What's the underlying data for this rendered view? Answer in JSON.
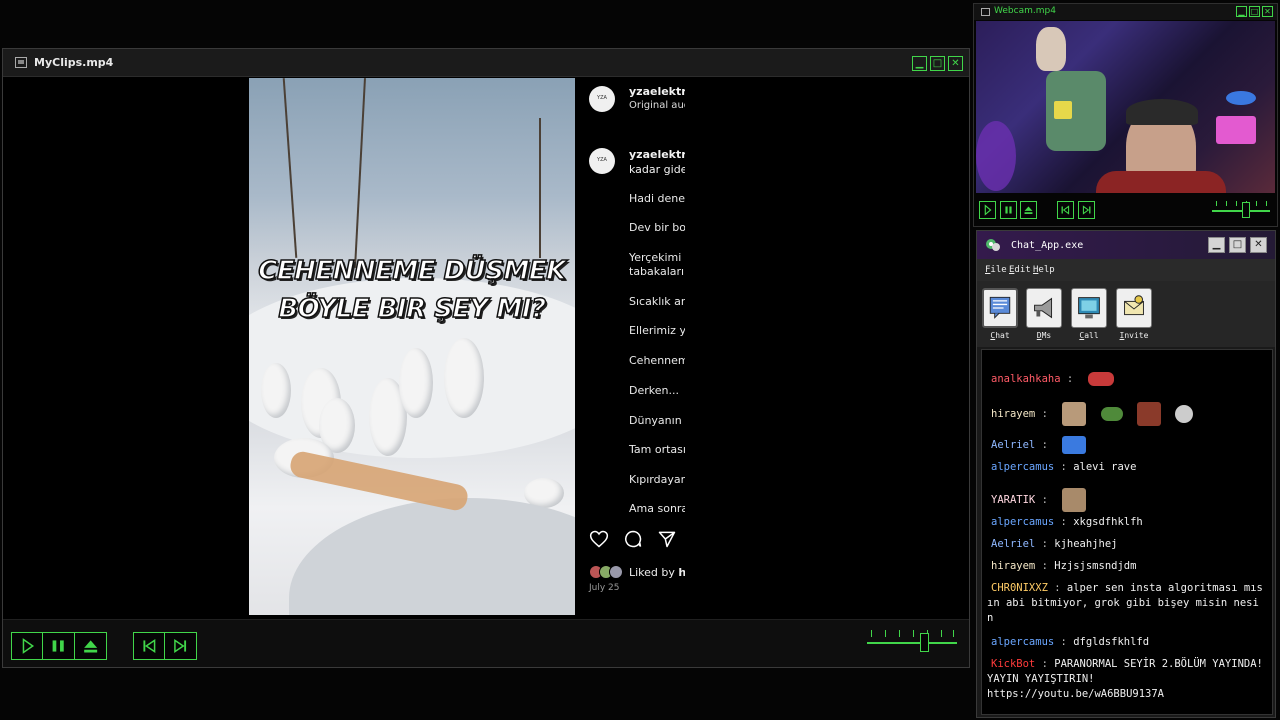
{
  "player": {
    "title": "MyClips.mp4",
    "video_caption_line1": "CEHENNEME DÜŞMEK",
    "video_caption_line2": "BÖYLE BIR ŞEY MI?",
    "ig": {
      "avatar_label": "YZA",
      "username": "yzaelektror",
      "audio": "Original audi",
      "comment_user": "yzaelektror",
      "comment_line2": "kadar gidel",
      "lines": [
        "Hadi deney",
        "Dev bir bor",
        "Yerçekimi b",
        "tabakaları..",
        "Sıcaklık art",
        "Ellerimiz ya",
        "Cehennem",
        "Derken...",
        "Dünyanın r",
        "Tam ortası.",
        "Kıpırdayam",
        "Ama sonra"
      ],
      "liked_by_prefix": "Liked by ",
      "liked_by_name": "h",
      "date": "July 25"
    },
    "volume_level": 0.65,
    "accent_color": "#41d64a"
  },
  "webcam": {
    "title": "Webcam.mp4",
    "volume_level": 0.6
  },
  "chat": {
    "title": "Chat_App.exe",
    "menu": [
      "File",
      "Edit",
      "Help"
    ],
    "tabs": [
      {
        "label": "Chat",
        "icon": "chat-icon"
      },
      {
        "label": "DMs",
        "icon": "megaphone-icon"
      },
      {
        "label": "Call",
        "icon": "monitor-icon"
      },
      {
        "label": "Invite",
        "icon": "mail-icon"
      }
    ],
    "messages": [
      {
        "user": "analkahkaha",
        "color": "#ff5b67",
        "text": ""
      },
      {
        "user": "hirayem",
        "color": "#f5e8c8",
        "text": ""
      },
      {
        "user": "Aelriel",
        "color": "#8fb8ff",
        "text": ""
      },
      {
        "user": "alpercamus",
        "color": "#6aa6ff",
        "text": "alevi rave"
      },
      {
        "user": "YARATIK",
        "color": "#ffd7e0",
        "text": ""
      },
      {
        "user": "alpercamus",
        "color": "#6aa6ff",
        "text": "xkgsdfhklfh"
      },
      {
        "user": "Aelriel",
        "color": "#8fb8ff",
        "text": "kjheahjhej"
      },
      {
        "user": "hirayem",
        "color": "#f5e8c8",
        "text": "Hzjsjsmsndjdm"
      },
      {
        "user": "CHR0NIXXZ",
        "color": "#ffcc66",
        "text": "alper sen insta algoritması mıs ın abi bitmiyor, grok gibi bişey misin nesi n"
      },
      {
        "user": "alpercamus",
        "color": "#6aa6ff",
        "text": "dfgldsfkhlfd"
      },
      {
        "user": "KickBot",
        "color": "#ff3b3b",
        "text": "PARANORMAL SEYİR 2.BÖLÜM YAYINDA! YAYIN YAYIŞTIRIN! https://youtu.be/wA6BBU9137A"
      }
    ],
    "separator": ":"
  }
}
